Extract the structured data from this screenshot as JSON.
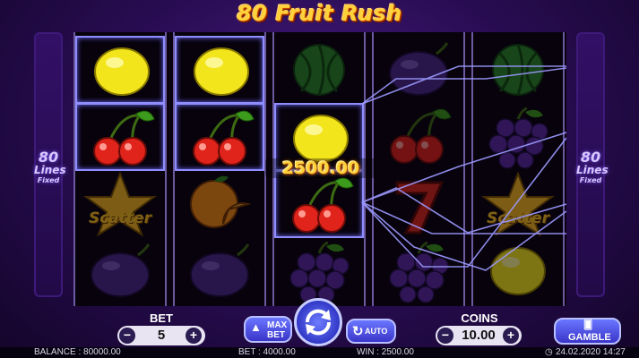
{
  "title": "80 Fruit Rush",
  "side_panel": {
    "number": "80",
    "lines": "Lines",
    "fixed": "Fixed"
  },
  "reels": [
    [
      "lemon",
      "cherry",
      "scatter",
      "plum"
    ],
    [
      "lemon",
      "cherry",
      "orange",
      "plum"
    ],
    [
      "watermelon",
      "lemon",
      "cherry",
      "grapes"
    ],
    [
      "plum",
      "cherry",
      "seven",
      "grapes"
    ],
    [
      "watermelon",
      "grapes",
      "scatter",
      "lemon"
    ]
  ],
  "symbol_text": {
    "scatter": "Scatter"
  },
  "win_display": "2500.00",
  "bet": {
    "label": "BET",
    "value": "5",
    "minus": "−",
    "plus": "+"
  },
  "coins": {
    "label": "COINS",
    "value": "10.00",
    "minus": "−",
    "plus": "+"
  },
  "max_bet": {
    "line1": "MAX",
    "line2": "BET"
  },
  "auto_label": "AUTO",
  "gamble_label": "GAMBLE",
  "status": {
    "balance": "BALANCE : 80000.00",
    "bet": "BET : 4000.00",
    "win": "WIN : 2500.00",
    "datetime": "24.02.2020 14:27"
  },
  "colors": {
    "accent": "#ffd23b",
    "button": "#4a4fe0",
    "background": "#2a0d55"
  }
}
